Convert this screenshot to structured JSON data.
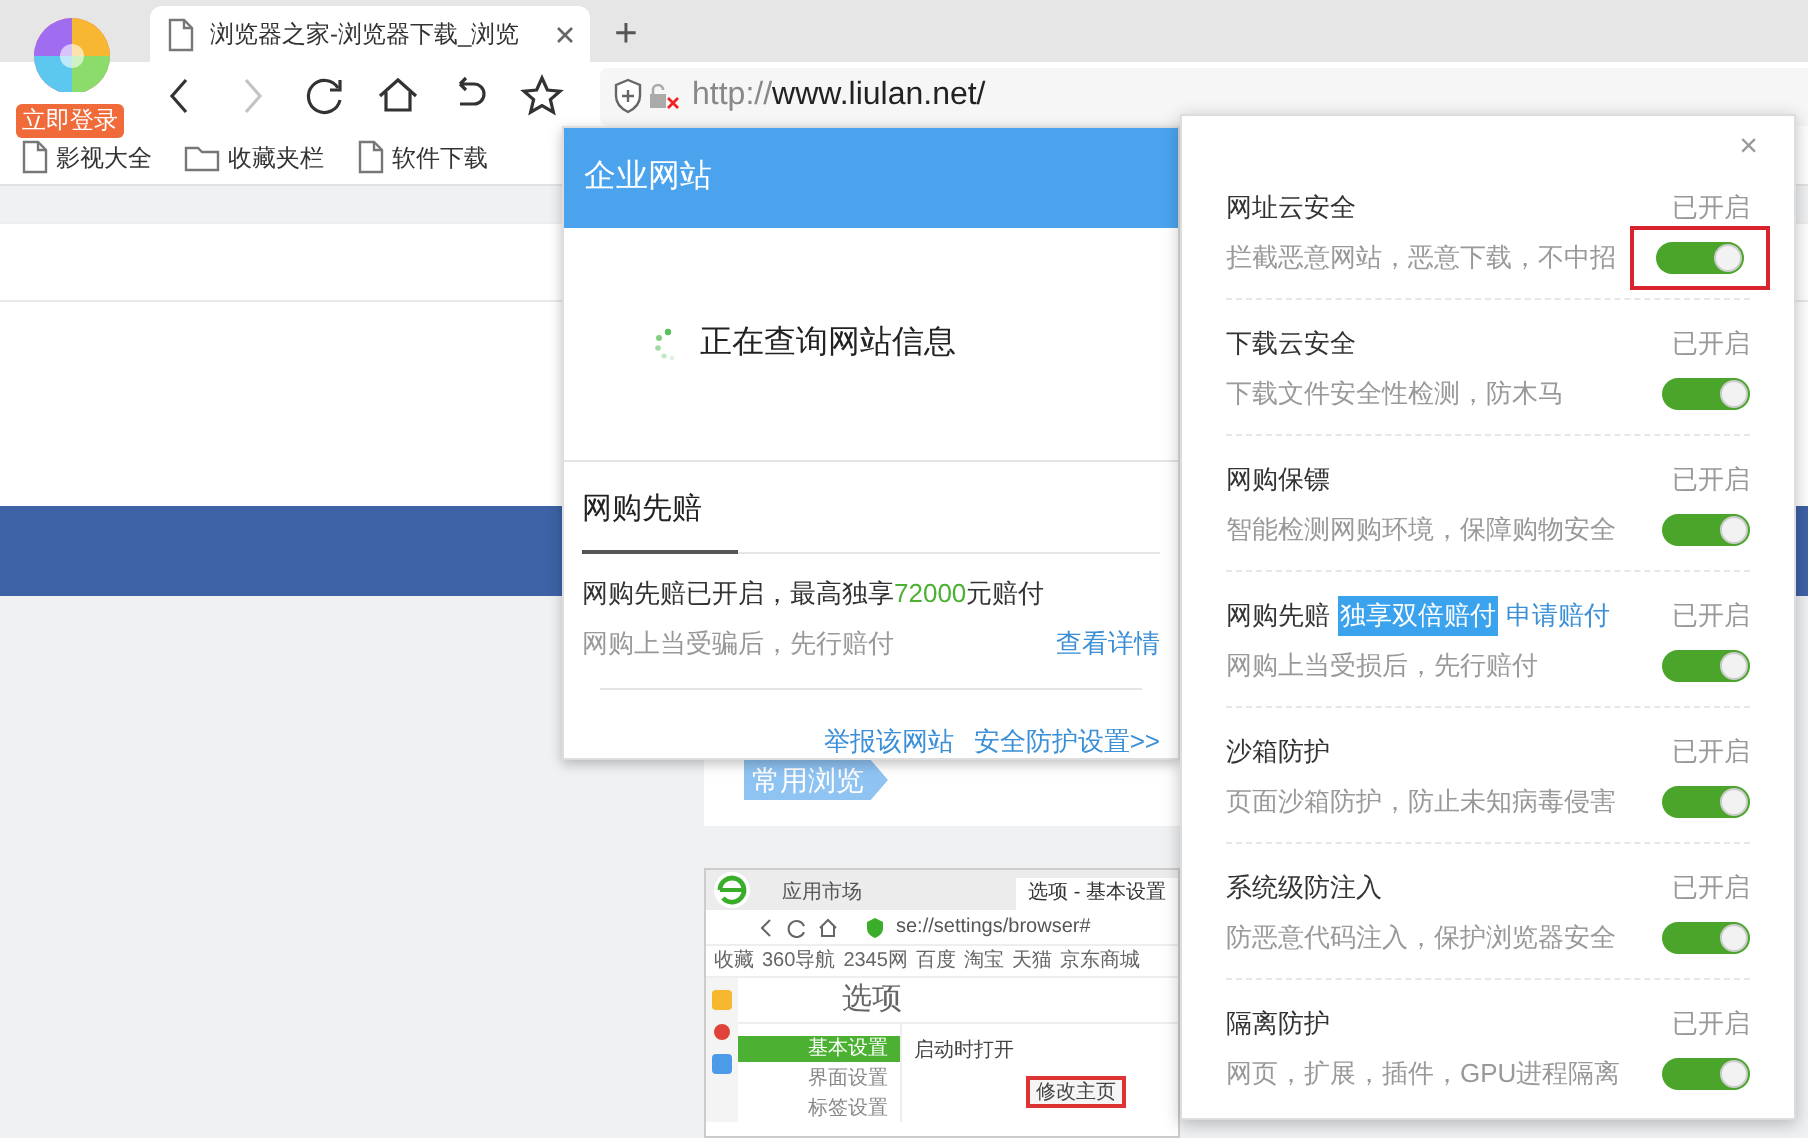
{
  "browser": {
    "login_badge": "立即登录",
    "tab": {
      "title": "浏览器之家-浏览器下载_浏览",
      "selected": true
    },
    "new_tab": "+",
    "forward_disabled": true,
    "url_scheme": "http://",
    "url_host": "www.liulan.net/",
    "bookmarks": [
      {
        "kind": "page",
        "label": "影视大全"
      },
      {
        "kind": "folder",
        "label": "收藏夹栏"
      },
      {
        "kind": "page",
        "label": "软件下载"
      }
    ]
  },
  "page": {
    "tag": "常用浏览",
    "inner_screenshot": {
      "tabs": [
        {
          "label": "应用市场",
          "selected": false
        },
        {
          "label": "选项 - 基本设置",
          "selected": true
        }
      ],
      "url": "se://settings/browser#",
      "bookmarks": [
        "收藏",
        "360导航",
        "2345网",
        "百度",
        "淘宝",
        "天猫",
        "京东商城"
      ],
      "heading": "选项",
      "menu": [
        {
          "label": "基本设置",
          "selected": true
        },
        {
          "label": "界面设置",
          "selected": false
        },
        {
          "label": "标签设置",
          "selected": false
        }
      ],
      "startup_label": "启动时打开",
      "button": "修改主页"
    }
  },
  "site_popup": {
    "title": "企业网站",
    "status": "正在查询网站信息",
    "section_title": "网购先赔",
    "message_parts": [
      "网购先赔已开启，最高独享",
      "72000",
      "元赔付"
    ],
    "note": "网购上当受骗后，先行赔付",
    "details_link": "查看详情",
    "footer_links": [
      "举报该网站",
      "安全防护设置>>"
    ]
  },
  "security_panel": {
    "close": "×",
    "items": [
      {
        "title": "网址云安全",
        "status": "已开启",
        "description": "拦截恶意网站，恶意下载，不中招",
        "on": true,
        "highlighted": true
      },
      {
        "title": "下载云安全",
        "status": "已开启",
        "description": "下载文件安全性检测，防木马",
        "on": true,
        "highlighted": false
      },
      {
        "title": "网购保镖",
        "status": "已开启",
        "description": "智能检测网购环境，保障购物安全",
        "on": true,
        "highlighted": false
      },
      {
        "title": "网购先赔",
        "badge": "独享双倍赔付",
        "link": "申请赔付",
        "status": "已开启",
        "description": "网购上当受损后，先行赔付",
        "on": true,
        "highlighted": false
      },
      {
        "title": "沙箱防护",
        "status": "已开启",
        "description": "页面沙箱防护，防止未知病毒侵害",
        "on": true,
        "highlighted": false
      },
      {
        "title": "系统级防注入",
        "status": "已开启",
        "description": "防恶意代码注入，保护浏览器安全",
        "on": true,
        "highlighted": false
      },
      {
        "title": "隔离防护",
        "status": "已开启",
        "description": "网页，扩展，插件，GPU进程隔离",
        "on": true,
        "highlighted": false
      }
    ]
  }
}
